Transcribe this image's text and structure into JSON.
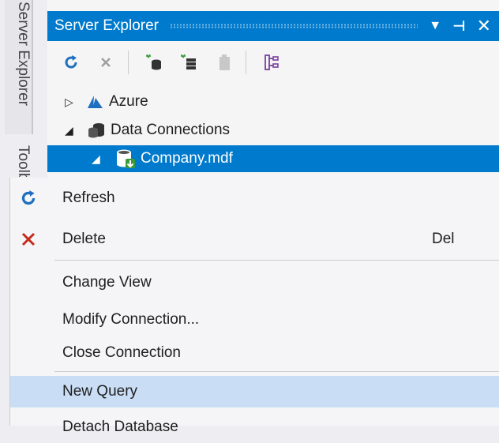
{
  "side_tabs": {
    "server_explorer": "Server Explorer",
    "toolbox": "Toolbox"
  },
  "panel": {
    "title": "Server Explorer",
    "tree": [
      {
        "label": "Azure",
        "expanded": false
      },
      {
        "label": "Data Connections",
        "expanded": true
      },
      {
        "label": "Company.mdf",
        "expanded": true,
        "selected": true
      }
    ]
  },
  "toolbar": {
    "icons": [
      "refresh-icon",
      "stop-icon",
      "connect-database-icon",
      "connect-server-icon",
      "sharepoint-connection-icon",
      "view-diagram-icon"
    ]
  },
  "context_menu": {
    "items": [
      {
        "label": "Refresh",
        "icon": "refresh-icon",
        "shortcut": ""
      },
      {
        "label": "Delete",
        "icon": "delete-icon",
        "shortcut": "Del"
      },
      {
        "label": "Change View",
        "icon": "",
        "shortcut": ""
      },
      {
        "label": "Modify Connection...",
        "icon": "",
        "shortcut": ""
      },
      {
        "label": "Close Connection",
        "icon": "",
        "shortcut": ""
      },
      {
        "label": "New Query",
        "icon": "",
        "shortcut": "",
        "highlighted": true
      },
      {
        "label": "Detach Database",
        "icon": "",
        "shortcut": ""
      }
    ]
  },
  "colors": {
    "accent": "#007acc",
    "menu_hover": "#c9def5",
    "refresh": "#1e6fc0",
    "delete": "#c42b1c"
  }
}
